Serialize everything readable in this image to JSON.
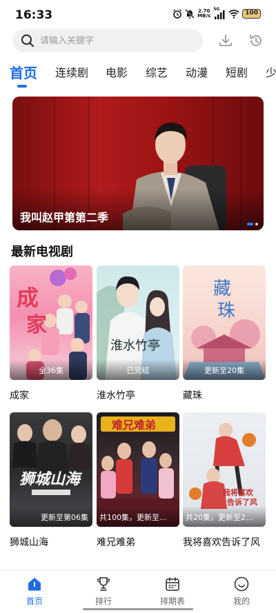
{
  "status_bar": {
    "time": "16:33",
    "net_speed_value": "2.70",
    "net_speed_unit": "MB/s",
    "signal_label": "5G",
    "battery": "100"
  },
  "search": {
    "placeholder": "请输入关键字"
  },
  "top_actions": {
    "download_icon": "download-icon",
    "history_icon": "history-icon"
  },
  "tabs": [
    {
      "label": "首页",
      "active": true
    },
    {
      "label": "连续剧"
    },
    {
      "label": "电影"
    },
    {
      "label": "综艺"
    },
    {
      "label": "动漫"
    },
    {
      "label": "短剧"
    },
    {
      "label": "少"
    }
  ],
  "banner": {
    "title": "我叫赵甲第第二季",
    "dot_count": 2,
    "active_dot": 0
  },
  "section": {
    "title": "最新电视剧"
  },
  "shows": [
    {
      "title": "成家",
      "badge": "全36集",
      "poster_text": "成家"
    },
    {
      "title": "淮水竹亭",
      "badge": "已完结",
      "poster_text": "淮水竹亭"
    },
    {
      "title": "藏珠",
      "badge": "更新至20集",
      "poster_text": "藏珠"
    },
    {
      "title": "狮城山海",
      "badge": "更新至第06集",
      "poster_text": "狮城山海"
    },
    {
      "title": "难兄难弟",
      "badge": "共100集，更新至...",
      "poster_text": "难兄难弟"
    },
    {
      "title": "我将喜欢告诉了风",
      "badge": "共20集，更新至2...",
      "poster_text": "我将喜欢告诉了风"
    }
  ],
  "bottom_nav": [
    {
      "label": "首页",
      "icon": "home-icon",
      "active": true
    },
    {
      "label": "排行",
      "icon": "trophy-icon"
    },
    {
      "label": "排期表",
      "icon": "calendar-icon"
    },
    {
      "label": "我的",
      "icon": "profile-icon"
    }
  ],
  "colors": {
    "accent": "#1f6be8",
    "text": "#111111",
    "muted": "#666666",
    "search_bg": "#f1f1f4"
  }
}
